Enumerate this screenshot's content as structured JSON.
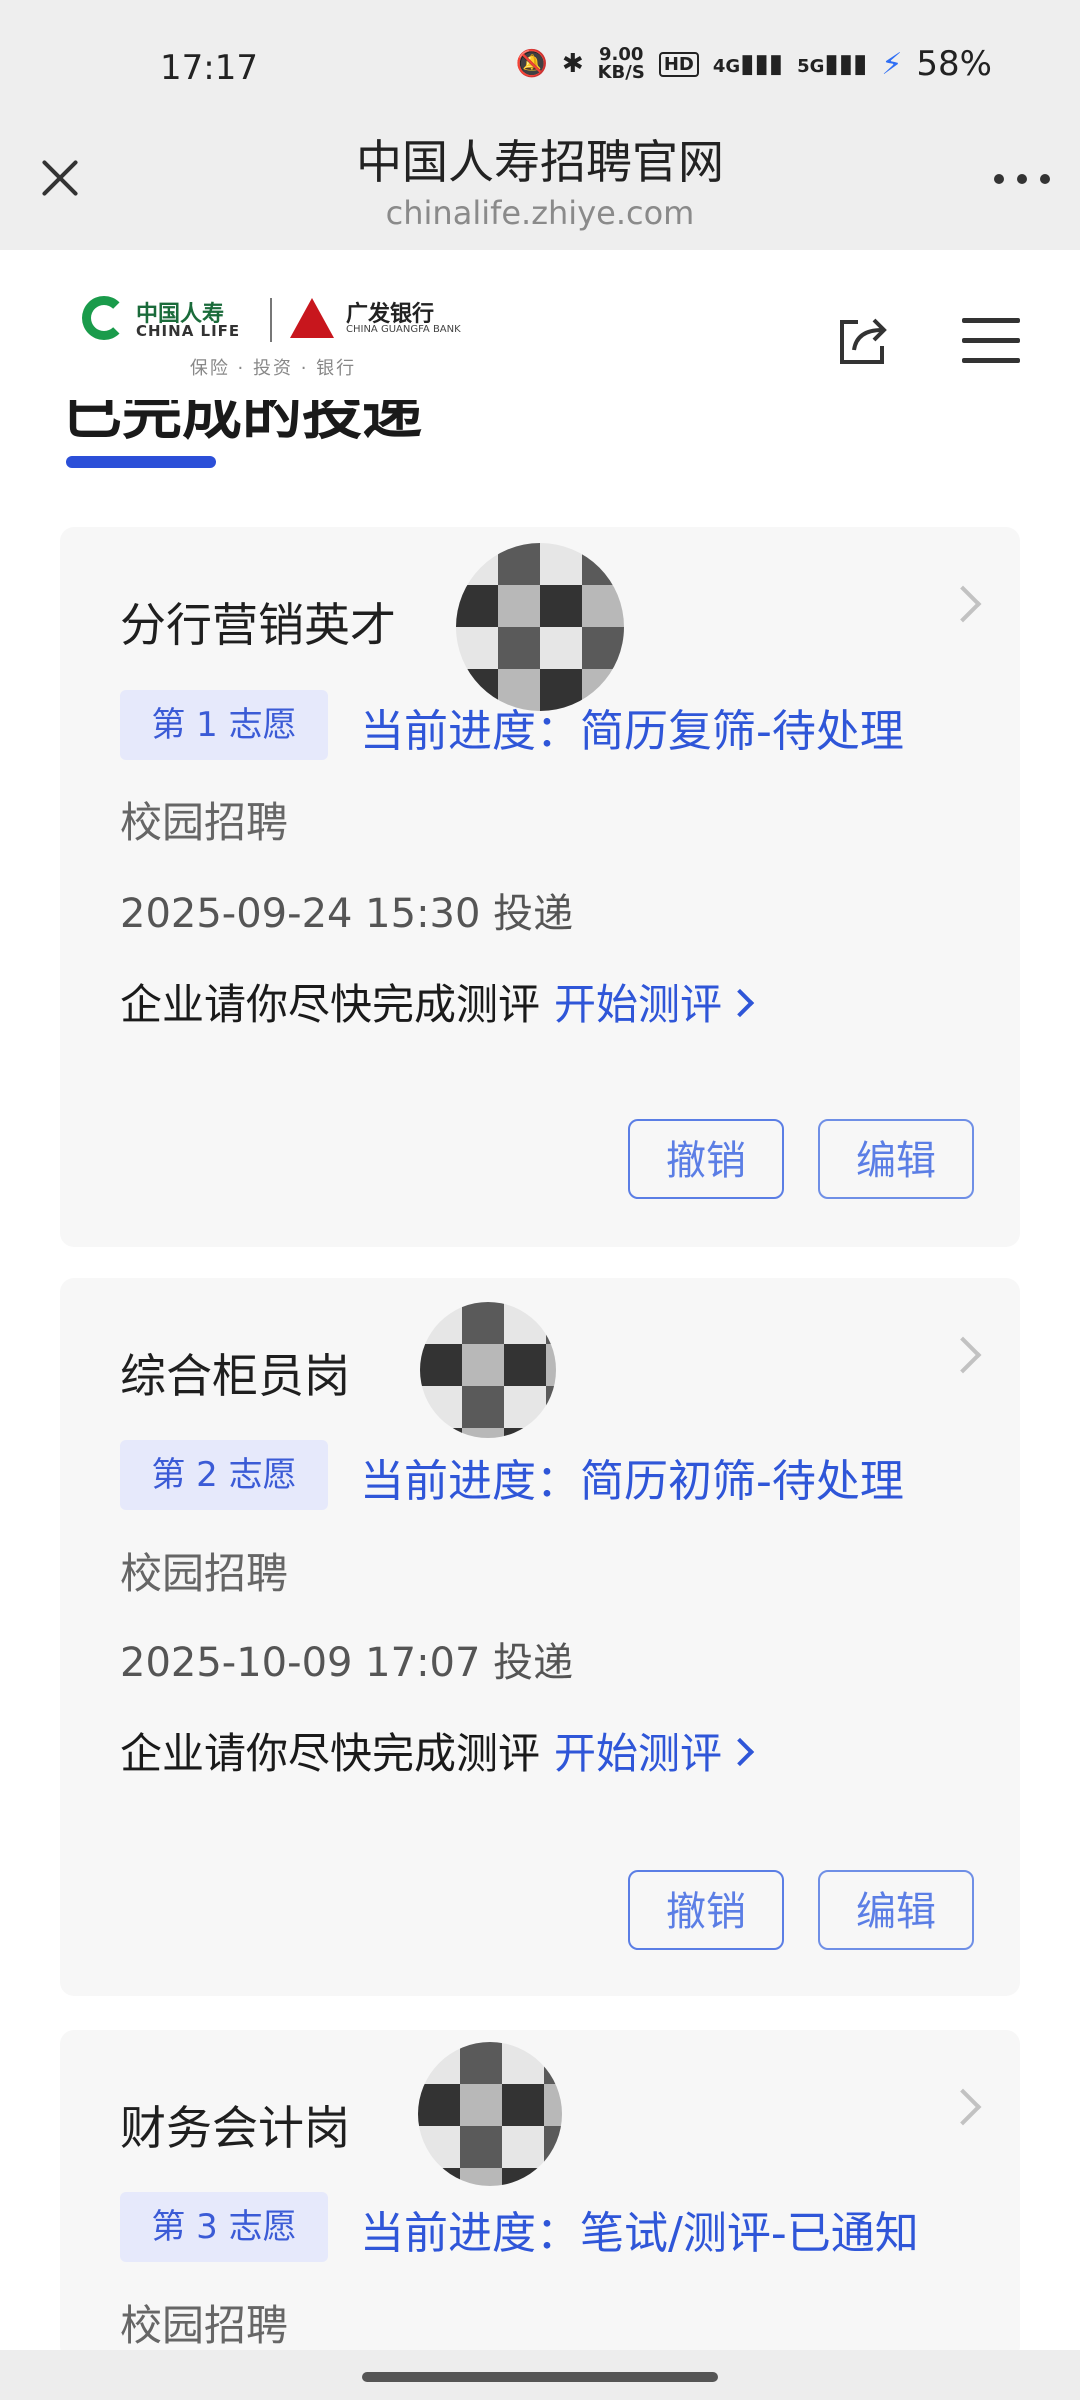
{
  "status_bar": {
    "time": "17:17",
    "net_speed_top": "9.00",
    "net_speed_bottom": "KB/S",
    "hd_label": "HD",
    "signal1": "4G",
    "signal2": "5G",
    "battery": "58%"
  },
  "browser": {
    "title": "中国人寿招聘官网",
    "url": "chinalife.zhiye.com"
  },
  "brand": {
    "chinalife_cn": "中国人寿",
    "chinalife_en": "CHINA LIFE",
    "cgb_cn": "广发银行",
    "cgb_en": "CHINA GUANGFA BANK",
    "tagline": "保险 · 投资 · 银行"
  },
  "section": {
    "title": "已完成的投递"
  },
  "cards": [
    {
      "title": "分行营销英才",
      "priority": "第 1 志愿",
      "progress": "当前进度：简历复筛-待处理",
      "channel": "校园招聘",
      "submitted": "2025-09-24 15:30 投递",
      "assess_prompt": "企业请你尽快完成测评",
      "assess_link": "开始测评",
      "cancel": "撤销",
      "edit": "编辑"
    },
    {
      "title": "综合柜员岗",
      "priority": "第 2 志愿",
      "progress": "当前进度：简历初筛-待处理",
      "channel": "校园招聘",
      "submitted": "2025-10-09 17:07 投递",
      "assess_prompt": "企业请你尽快完成测评",
      "assess_link": "开始测评",
      "cancel": "撤销",
      "edit": "编辑"
    },
    {
      "title": "财务会计岗",
      "priority": "第 3 志愿",
      "progress": "当前进度：笔试/测评-已通知",
      "channel": "校园招聘"
    }
  ]
}
